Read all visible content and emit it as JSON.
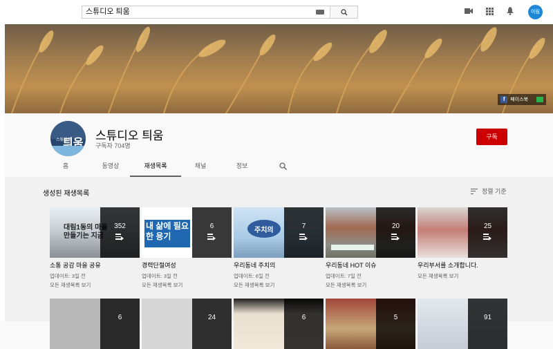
{
  "search": {
    "value": "스튜디오 틔움"
  },
  "header": {
    "avatar_initials": "이림"
  },
  "banner": {
    "facebook_label": "페이스북"
  },
  "channel": {
    "name": "스튜디오 틔움",
    "subscribers": "구독자 704명",
    "avatar_text": "틔움",
    "avatar_badge": "스튜디오",
    "subscribe_label": "구독"
  },
  "tabs": [
    "홈",
    "동영상",
    "재생목록",
    "채널",
    "정보"
  ],
  "section": {
    "title": "생성된 재생목록",
    "sort_label": "정렬 기준"
  },
  "playlists": [
    {
      "title": "소통 공감 마을 공유",
      "updated": "업데이트: 3일 전",
      "view_all": "모든 재생목록 보기",
      "count": "352",
      "thumb_text": "대림1동의 마을 만들기는 지금"
    },
    {
      "title": "경력단절여성",
      "updated": "업데이트: 3일 전",
      "view_all": "모든 재생목록 보기",
      "count": "6",
      "thumb_text": "내 삶에 필요한 용기"
    },
    {
      "title": "우리동네 주치의",
      "updated": "업데이트: 6일 전",
      "view_all": "모든 재생목록 보기",
      "count": "7",
      "thumb_text": "주치의"
    },
    {
      "title": "우리동네 HOT 이슈",
      "updated": "업데이트: 7일 전",
      "view_all": "모든 재생목록 보기",
      "count": "20",
      "thumb_text": ""
    },
    {
      "title": "우리부서를 소개합니다.",
      "updated": "",
      "view_all": "모든 재생목록 보기",
      "count": "25",
      "thumb_text": ""
    }
  ],
  "playlists_row2": [
    {
      "count": "6"
    },
    {
      "count": "24"
    },
    {
      "count": "6"
    },
    {
      "count": "5"
    },
    {
      "count": "91"
    }
  ]
}
